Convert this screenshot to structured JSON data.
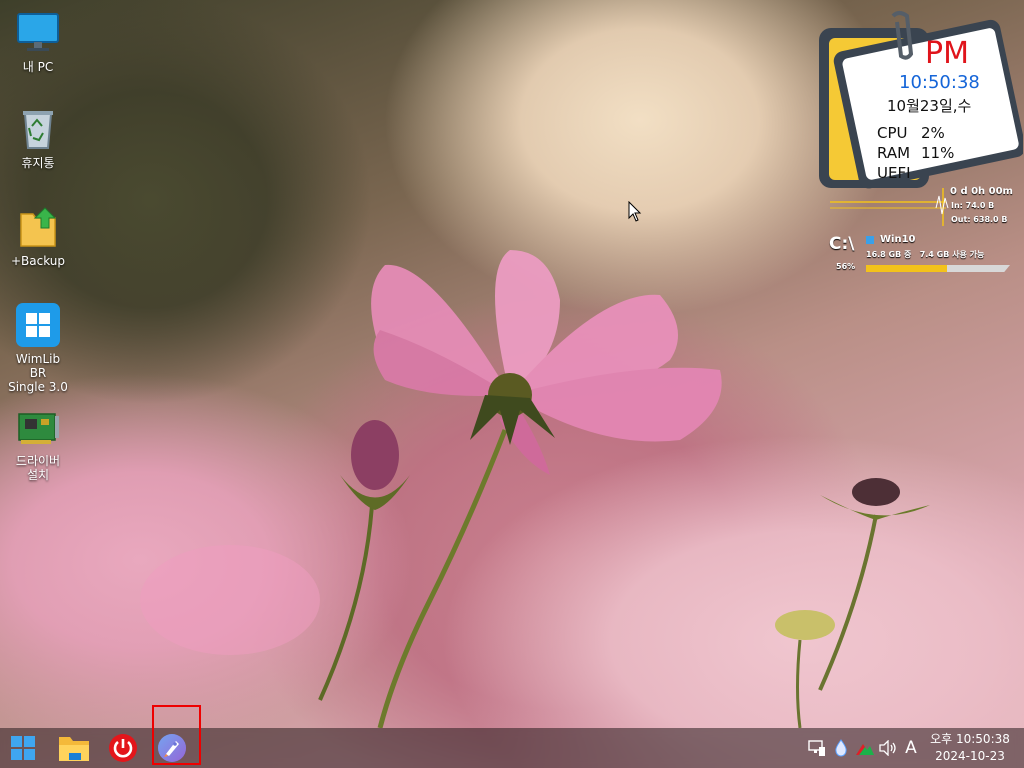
{
  "desktop": {
    "icons": [
      {
        "label": "내 PC",
        "icon": "monitor-icon"
      },
      {
        "label": "휴지통",
        "icon": "recycle-bin-icon"
      },
      {
        "label": "+Backup",
        "icon": "folder-upload-icon"
      },
      {
        "label": "WimLib BR\nSingle 3.0",
        "icon": "windows-app-icon"
      },
      {
        "label": "드라이버\n설치",
        "icon": "network-card-icon"
      }
    ]
  },
  "clock_gadget": {
    "ampm": "PM",
    "time": "10:50:38",
    "date": "10월23일,수",
    "cpu_label": "CPU",
    "cpu_value": "2%",
    "ram_label": "RAM",
    "ram_value": "11%",
    "firmware": "UEFI",
    "colors": {
      "ampm": "#e0141b",
      "time": "#1565d8",
      "note_yellow": "#f5c935",
      "frame_dark": "#3a4450"
    }
  },
  "net_meter": {
    "uptime": "0 d 0h 00m",
    "in": "In: 74.0 B",
    "out": "Out: 638.0 B"
  },
  "drive_gadget": {
    "drive": "C:\\",
    "percent": "56%",
    "name": "Win10",
    "usage_text": "16.8 GB 중   7.4 GB 사용 가능",
    "used_fraction": 0.56,
    "colors": {
      "bar": "#f3c21b",
      "track": "#d8d8d8"
    }
  },
  "taskbar": {
    "apps": [
      {
        "icon": "windows-start-icon"
      },
      {
        "icon": "file-explorer-icon"
      },
      {
        "icon": "power-icon"
      },
      {
        "icon": "rocket-launcher-icon"
      }
    ],
    "tray": {
      "ime": "A"
    },
    "clock": {
      "time": "오후 10:50:38",
      "date": "2024-10-23"
    }
  }
}
